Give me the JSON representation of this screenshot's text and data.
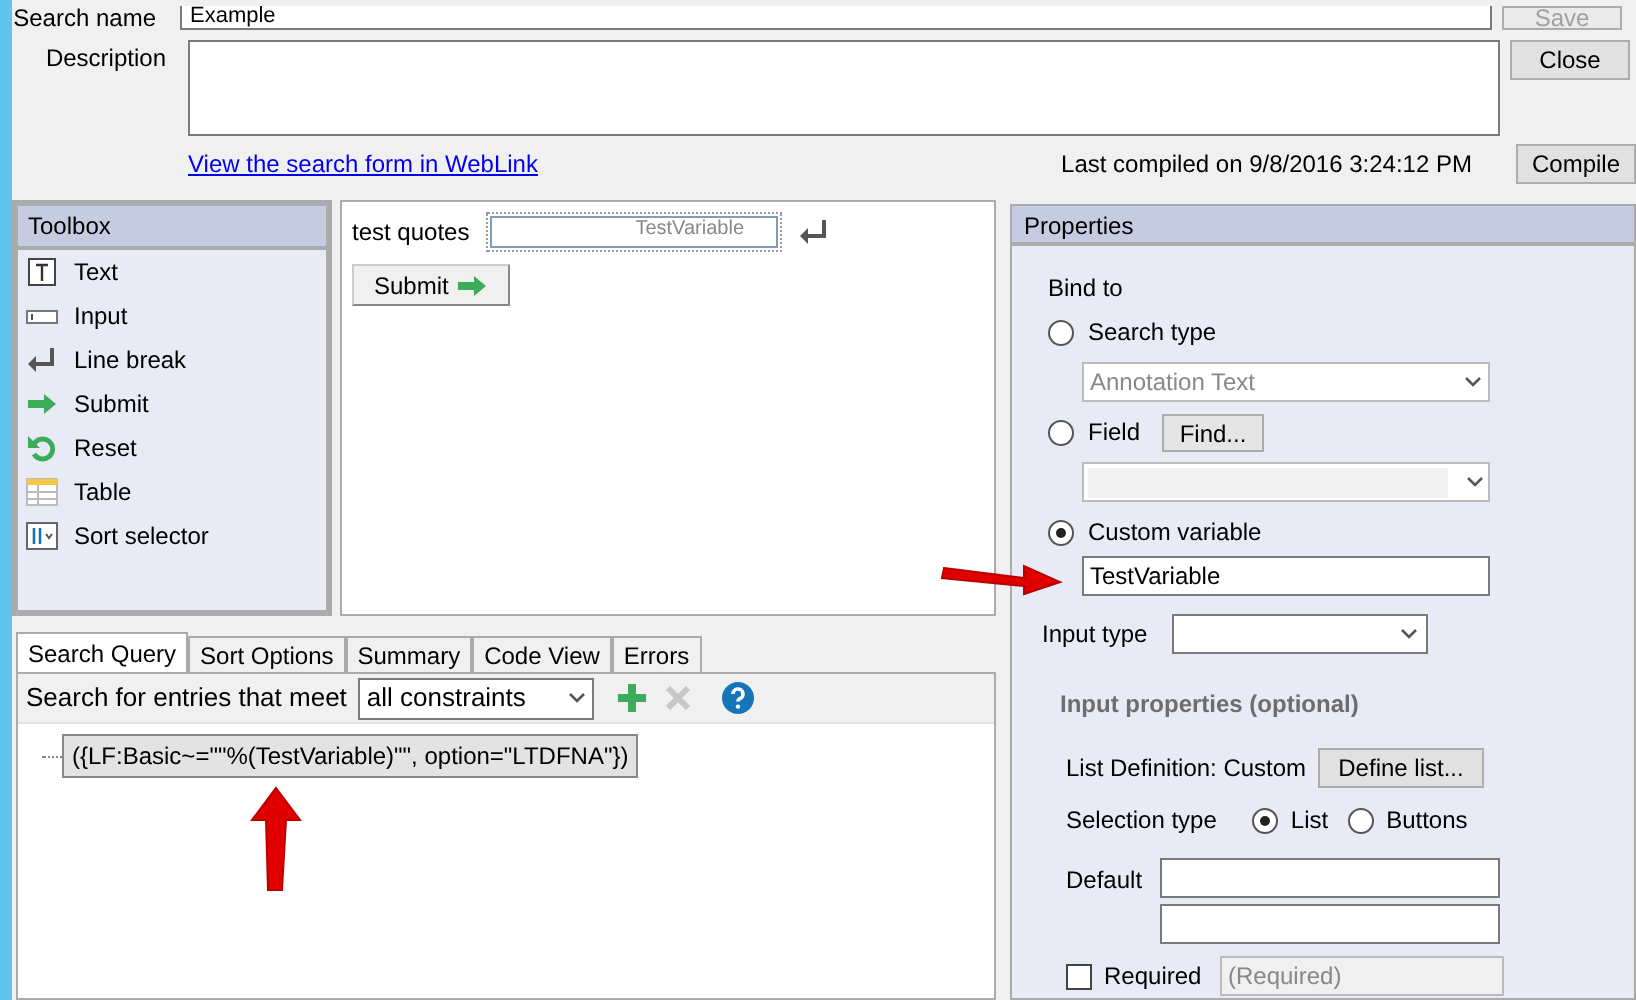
{
  "search_name": {
    "label": "Search name",
    "value": "Example"
  },
  "description": {
    "label": "Description"
  },
  "side_buttons": [
    {
      "label": "Save",
      "disabled": true
    },
    {
      "label": "Close",
      "disabled": false
    }
  ],
  "weblink": "View the search form in WebLink",
  "last_compiled": "Last compiled on 9/8/2016 3:24:12 PM",
  "compile_button": "Compile",
  "toolbox": {
    "title": "Toolbox",
    "items": [
      {
        "label": "Text",
        "kind": "text"
      },
      {
        "label": "Input",
        "kind": "input"
      },
      {
        "label": "Line break",
        "kind": "linebreak"
      },
      {
        "label": "Submit",
        "kind": "submit"
      },
      {
        "label": "Reset",
        "kind": "reset"
      },
      {
        "label": "Table",
        "kind": "table"
      },
      {
        "label": "Sort selector",
        "kind": "sort"
      }
    ]
  },
  "canvas": {
    "label": "test quotes",
    "input_value": "TestVariable",
    "submit": "Submit"
  },
  "tabs": [
    {
      "label": "Search Query",
      "selected": true
    },
    {
      "label": "Sort Options",
      "selected": false
    },
    {
      "label": "Summary",
      "selected": false
    },
    {
      "label": "Code View",
      "selected": false
    },
    {
      "label": "Errors",
      "selected": false
    }
  ],
  "query": {
    "label": "Search for entries that meet",
    "match": "all constraints",
    "expression": "({LF:Basic~=\"\"%(TestVariable)\"\", option=\"LTDFNA\"})"
  },
  "properties": {
    "title": "Properties",
    "bind_label": "Bind to",
    "bind_options": [
      {
        "label": "Search type",
        "selected": false,
        "kind": "dropdown",
        "value": "Annotation Text"
      },
      {
        "label": "Field",
        "selected": false,
        "kind": "field",
        "button": "Find..."
      },
      {
        "label": "Custom variable",
        "selected": true,
        "kind": "text",
        "value": "TestVariable"
      }
    ],
    "input_type_label": "Input type",
    "section_title": "Input properties (optional)",
    "list_definition": "List Definition: Custom",
    "define_button": "Define list...",
    "selection_label": "Selection type",
    "selection_options": [
      {
        "label": "List",
        "selected": true
      },
      {
        "label": "Buttons",
        "selected": false
      }
    ],
    "default_label": "Default",
    "required": {
      "label": "Required",
      "checked": false,
      "placeholder": "(Required)"
    }
  }
}
